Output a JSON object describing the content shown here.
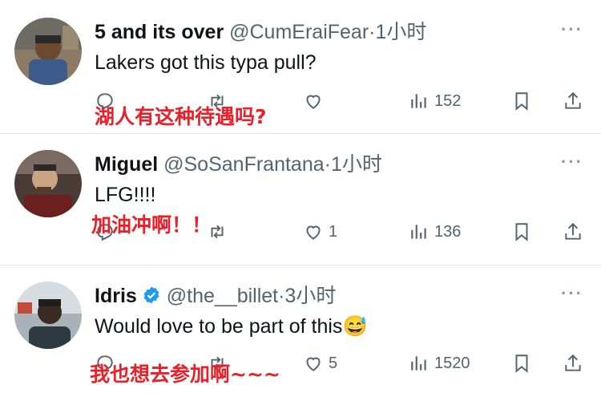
{
  "tweets": [
    {
      "name": "5 and its over",
      "handle": "@CumEraiFear",
      "time": "·1小时",
      "text": "Lakers got this typa pull?",
      "reply_count": "",
      "repost_count": "",
      "like_count": "",
      "views": "152",
      "overlay": "湖人有这种待遇吗?"
    },
    {
      "name": "Miguel",
      "handle": "@SoSanFrantana",
      "time": "·1小时",
      "text": "LFG!!!!",
      "reply_count": "",
      "repost_count": "",
      "like_count": "1",
      "views": "136",
      "overlay": "加油冲啊！！"
    },
    {
      "name": "Idris",
      "handle": "@the__billet",
      "time": "·3小时",
      "text": "Would love to be part of this",
      "emoji": "😅",
      "reply_count": "",
      "repost_count": "",
      "like_count": "5",
      "views": "1520",
      "overlay": "我也想去参加啊~~~"
    }
  ],
  "more_glyph": "···",
  "colors": {
    "overlay": "#e8202a",
    "verified": "#1d9bf0",
    "muted": "#536471"
  }
}
